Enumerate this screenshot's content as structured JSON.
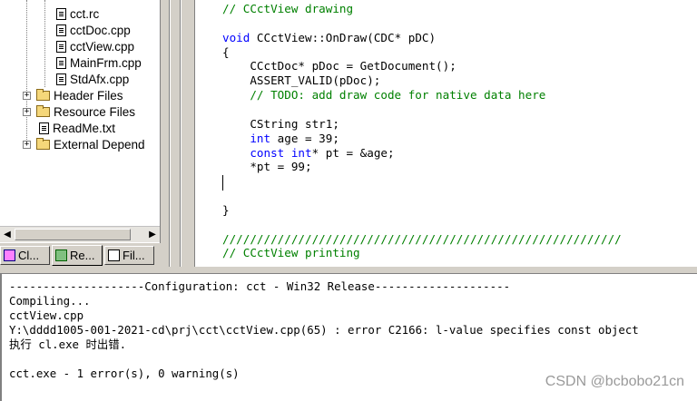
{
  "file_tree": {
    "items": [
      {
        "label": "cct.rc",
        "icon": "file-icon"
      },
      {
        "label": "cctDoc.cpp",
        "icon": "file-icon"
      },
      {
        "label": "cctView.cpp",
        "icon": "file-icon"
      },
      {
        "label": "MainFrm.cpp",
        "icon": "file-icon"
      },
      {
        "label": "StdAfx.cpp",
        "icon": "file-icon"
      },
      {
        "label": "Header Files",
        "icon": "folder-icon",
        "expander": "+"
      },
      {
        "label": "Resource Files",
        "icon": "folder-icon",
        "expander": "+"
      },
      {
        "label": "ReadMe.txt",
        "icon": "file-icon"
      },
      {
        "label": "External Depend",
        "icon": "folder-icon",
        "expander": "+"
      }
    ]
  },
  "workspace_tabs": [
    {
      "label": "Cl...",
      "icon": "class-view-icon"
    },
    {
      "label": "Re...",
      "icon": "resource-view-icon"
    },
    {
      "label": "Fil...",
      "icon": "file-view-icon"
    }
  ],
  "editor": {
    "lines": [
      {
        "parts": [
          {
            "t": "// CCctView drawing",
            "c": "cm"
          }
        ]
      },
      {
        "parts": []
      },
      {
        "parts": [
          {
            "t": "void",
            "c": "kw"
          },
          {
            "t": " CCctView::OnDraw(CDC* pDC)",
            "c": ""
          }
        ]
      },
      {
        "parts": [
          {
            "t": "{",
            "c": ""
          }
        ]
      },
      {
        "parts": [
          {
            "t": "    CCctDoc* pDoc = GetDocument();",
            "c": ""
          }
        ]
      },
      {
        "parts": [
          {
            "t": "    ASSERT_VALID(pDoc);",
            "c": ""
          }
        ]
      },
      {
        "parts": [
          {
            "t": "    // TODO: add draw code for native data here",
            "c": "cm"
          }
        ]
      },
      {
        "parts": []
      },
      {
        "parts": [
          {
            "t": "    CString str1;",
            "c": ""
          }
        ]
      },
      {
        "parts": [
          {
            "t": "    ",
            "c": ""
          },
          {
            "t": "int",
            "c": "kw"
          },
          {
            "t": " age = 39;",
            "c": ""
          }
        ]
      },
      {
        "parts": [
          {
            "t": "    ",
            "c": ""
          },
          {
            "t": "const int",
            "c": "kw"
          },
          {
            "t": "* pt = &age;",
            "c": ""
          }
        ]
      },
      {
        "parts": [
          {
            "t": "    *pt = 99;",
            "c": ""
          }
        ]
      },
      {
        "parts": []
      },
      {
        "parts": []
      },
      {
        "parts": [
          {
            "t": "}",
            "c": ""
          }
        ]
      },
      {
        "parts": []
      },
      {
        "parts": [
          {
            "t": "//////////////////////////////////////////////////////////",
            "c": "cm"
          }
        ]
      },
      {
        "parts": [
          {
            "t": "// CCctView printing",
            "c": "cm"
          }
        ]
      }
    ]
  },
  "output": {
    "lines": [
      {
        "text": "--------------------Configuration: cct - Win32 Release--------------------",
        "selected": false
      },
      {
        "text": "Compiling...",
        "selected": false
      },
      {
        "text": "cctView.cpp",
        "selected": false
      },
      {
        "text": "Y:\\dddd1005-001-2021-cd\\prj\\cct\\cctView.cpp(65) : error C2166: l-value specifies const object",
        "selected": false
      },
      {
        "text": "执行 cl.exe 时出错.",
        "selected": false
      },
      {
        "text": "",
        "selected": false
      },
      {
        "text": "cct.exe - 1 error(s), 0 warning(s)",
        "selected": false
      }
    ]
  },
  "watermark": "CSDN @bcbobo21cn"
}
